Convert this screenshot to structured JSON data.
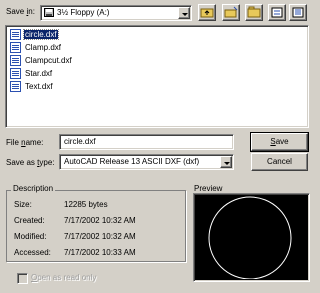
{
  "save_in": {
    "label_prefix": "Save ",
    "label_key": "i",
    "label_suffix": "n:",
    "value": "3½ Floppy (A:)"
  },
  "toolbar": {
    "buttons": [
      "up-one-level",
      "create-new-folder",
      "view-menu",
      "list-view",
      "details-view"
    ]
  },
  "files": [
    {
      "name": "circle.dxf",
      "selected": true
    },
    {
      "name": "Clamp.dxf",
      "selected": false
    },
    {
      "name": "Clampcut.dxf",
      "selected": false
    },
    {
      "name": "Star.dxf",
      "selected": false
    },
    {
      "name": "Text.dxf",
      "selected": false
    }
  ],
  "file_name": {
    "label_prefix": "File ",
    "label_key": "n",
    "label_suffix": "ame:",
    "value": "circle.dxf"
  },
  "save_as_type": {
    "label_prefix": "Save as ",
    "label_key": "t",
    "label_suffix": "ype:",
    "value": "AutoCAD Release 13 ASCII DXF (dxf)"
  },
  "buttons": {
    "save_key": "S",
    "save_rest": "ave",
    "cancel": "Cancel"
  },
  "description": {
    "title": "Description",
    "rows": [
      {
        "label": "Size:",
        "value": "12285 bytes"
      },
      {
        "label": "Created:",
        "value": "7/17/2002 10:32 AM"
      },
      {
        "label": "Modified:",
        "value": "7/17/2002 10:32 AM"
      },
      {
        "label": "Accessed:",
        "value": "7/17/2002 10:33 AM"
      }
    ]
  },
  "preview": {
    "title": "Preview"
  },
  "open_read_only": {
    "label_prefix": "",
    "label_key": "O",
    "label_suffix": "pen as read only",
    "checked": false
  }
}
